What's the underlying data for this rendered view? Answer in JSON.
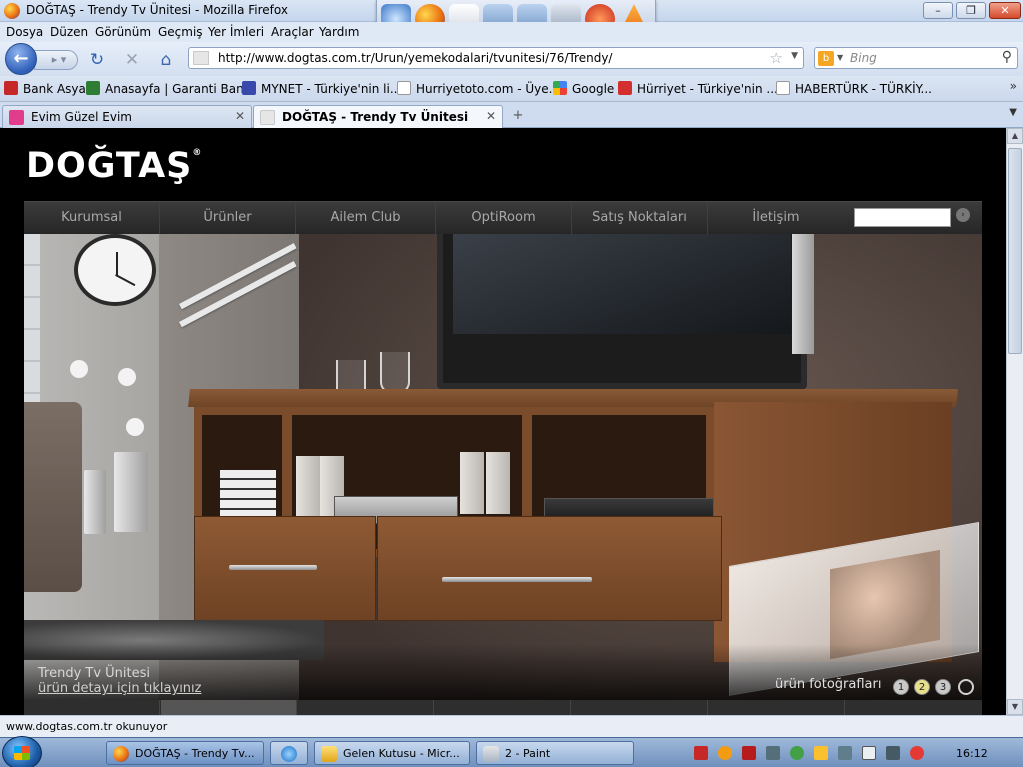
{
  "window": {
    "title": "DOĞTAŞ - Trendy Tv Ünitesi - Mozilla Firefox"
  },
  "menu": [
    "Dosya",
    "Düzen",
    "Görünüm",
    "Geçmiş",
    "Yer İmleri",
    "Araçlar",
    "Yardım"
  ],
  "nav": {
    "url": "http://www.dogtas.com.tr/Urun/yemekodalari/tvunitesi/76/Trendy/",
    "search_placeholder": "Bing"
  },
  "bookmarks": [
    "Bank Asya",
    "Anasayfa | Garanti Ban...",
    "MYNET - Türkiye'nin li...",
    "Hurriyetoto.com - Üye...",
    "Google",
    "Hürriyet - Türkiye'nin ...",
    "HABERTÜRK - TÜRKİY..."
  ],
  "bookmarks_more": "»",
  "tabs": [
    {
      "label": "Evim Güzel Evim",
      "active": false
    },
    {
      "label": "DOĞTAŞ - Trendy Tv Ünitesi",
      "active": true
    }
  ],
  "site": {
    "logo": "DOĞTAŞ",
    "logo_mark": "®",
    "nav": [
      "Kurumsal",
      "Ürünler",
      "Ailem Club",
      "OptiRoom",
      "Satış Noktaları",
      "İletişim"
    ],
    "product_name": "Trendy Tv Ünitesi",
    "product_link": "ürün detayı için tıklayınız",
    "photos_label": "ürün fotoğrafları",
    "photo_pages": [
      "1",
      "2",
      "3"
    ],
    "subnav": [
      "",
      "",
      "",
      "",
      "",
      "",
      ""
    ]
  },
  "status": {
    "text": "www.dogtas.com.tr okunuyor"
  },
  "taskbar": {
    "tasks": [
      {
        "label": "DOĞTAŞ - Trendy Tv...",
        "active": true
      },
      {
        "label": "",
        "active": false
      },
      {
        "label": "Gelen Kutusu - Micr...",
        "active": false
      },
      {
        "label": "2 - Paint",
        "active": false
      }
    ],
    "clock": "16:12"
  },
  "colors": {
    "page_bg": "#000000",
    "nav_bg": "#2f2f2f",
    "nav_text": "#a8a8a8",
    "dot_active": "#e8df8c"
  }
}
